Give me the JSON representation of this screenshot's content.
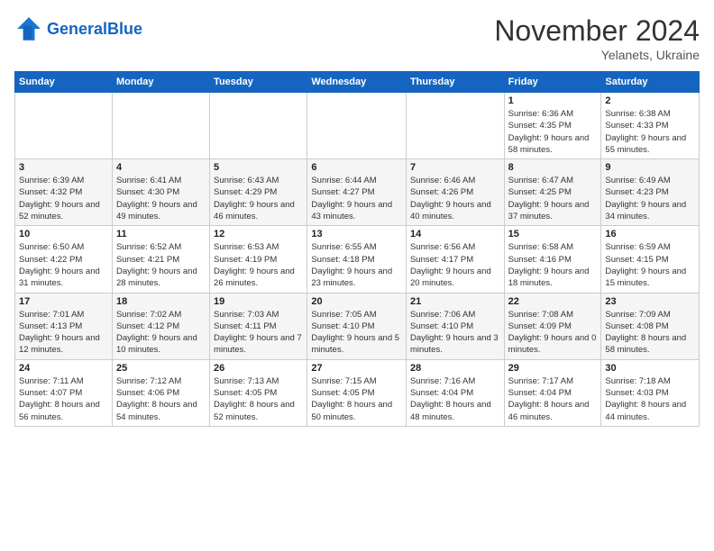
{
  "header": {
    "logo_text_general": "General",
    "logo_text_blue": "Blue",
    "month": "November 2024",
    "location": "Yelanets, Ukraine"
  },
  "days_of_week": [
    "Sunday",
    "Monday",
    "Tuesday",
    "Wednesday",
    "Thursday",
    "Friday",
    "Saturday"
  ],
  "weeks": [
    [
      {
        "day": "",
        "info": ""
      },
      {
        "day": "",
        "info": ""
      },
      {
        "day": "",
        "info": ""
      },
      {
        "day": "",
        "info": ""
      },
      {
        "day": "",
        "info": ""
      },
      {
        "day": "1",
        "info": "Sunrise: 6:36 AM\nSunset: 4:35 PM\nDaylight: 9 hours and 58 minutes."
      },
      {
        "day": "2",
        "info": "Sunrise: 6:38 AM\nSunset: 4:33 PM\nDaylight: 9 hours and 55 minutes."
      }
    ],
    [
      {
        "day": "3",
        "info": "Sunrise: 6:39 AM\nSunset: 4:32 PM\nDaylight: 9 hours and 52 minutes."
      },
      {
        "day": "4",
        "info": "Sunrise: 6:41 AM\nSunset: 4:30 PM\nDaylight: 9 hours and 49 minutes."
      },
      {
        "day": "5",
        "info": "Sunrise: 6:43 AM\nSunset: 4:29 PM\nDaylight: 9 hours and 46 minutes."
      },
      {
        "day": "6",
        "info": "Sunrise: 6:44 AM\nSunset: 4:27 PM\nDaylight: 9 hours and 43 minutes."
      },
      {
        "day": "7",
        "info": "Sunrise: 6:46 AM\nSunset: 4:26 PM\nDaylight: 9 hours and 40 minutes."
      },
      {
        "day": "8",
        "info": "Sunrise: 6:47 AM\nSunset: 4:25 PM\nDaylight: 9 hours and 37 minutes."
      },
      {
        "day": "9",
        "info": "Sunrise: 6:49 AM\nSunset: 4:23 PM\nDaylight: 9 hours and 34 minutes."
      }
    ],
    [
      {
        "day": "10",
        "info": "Sunrise: 6:50 AM\nSunset: 4:22 PM\nDaylight: 9 hours and 31 minutes."
      },
      {
        "day": "11",
        "info": "Sunrise: 6:52 AM\nSunset: 4:21 PM\nDaylight: 9 hours and 28 minutes."
      },
      {
        "day": "12",
        "info": "Sunrise: 6:53 AM\nSunset: 4:19 PM\nDaylight: 9 hours and 26 minutes."
      },
      {
        "day": "13",
        "info": "Sunrise: 6:55 AM\nSunset: 4:18 PM\nDaylight: 9 hours and 23 minutes."
      },
      {
        "day": "14",
        "info": "Sunrise: 6:56 AM\nSunset: 4:17 PM\nDaylight: 9 hours and 20 minutes."
      },
      {
        "day": "15",
        "info": "Sunrise: 6:58 AM\nSunset: 4:16 PM\nDaylight: 9 hours and 18 minutes."
      },
      {
        "day": "16",
        "info": "Sunrise: 6:59 AM\nSunset: 4:15 PM\nDaylight: 9 hours and 15 minutes."
      }
    ],
    [
      {
        "day": "17",
        "info": "Sunrise: 7:01 AM\nSunset: 4:13 PM\nDaylight: 9 hours and 12 minutes."
      },
      {
        "day": "18",
        "info": "Sunrise: 7:02 AM\nSunset: 4:12 PM\nDaylight: 9 hours and 10 minutes."
      },
      {
        "day": "19",
        "info": "Sunrise: 7:03 AM\nSunset: 4:11 PM\nDaylight: 9 hours and 7 minutes."
      },
      {
        "day": "20",
        "info": "Sunrise: 7:05 AM\nSunset: 4:10 PM\nDaylight: 9 hours and 5 minutes."
      },
      {
        "day": "21",
        "info": "Sunrise: 7:06 AM\nSunset: 4:10 PM\nDaylight: 9 hours and 3 minutes."
      },
      {
        "day": "22",
        "info": "Sunrise: 7:08 AM\nSunset: 4:09 PM\nDaylight: 9 hours and 0 minutes."
      },
      {
        "day": "23",
        "info": "Sunrise: 7:09 AM\nSunset: 4:08 PM\nDaylight: 8 hours and 58 minutes."
      }
    ],
    [
      {
        "day": "24",
        "info": "Sunrise: 7:11 AM\nSunset: 4:07 PM\nDaylight: 8 hours and 56 minutes."
      },
      {
        "day": "25",
        "info": "Sunrise: 7:12 AM\nSunset: 4:06 PM\nDaylight: 8 hours and 54 minutes."
      },
      {
        "day": "26",
        "info": "Sunrise: 7:13 AM\nSunset: 4:05 PM\nDaylight: 8 hours and 52 minutes."
      },
      {
        "day": "27",
        "info": "Sunrise: 7:15 AM\nSunset: 4:05 PM\nDaylight: 8 hours and 50 minutes."
      },
      {
        "day": "28",
        "info": "Sunrise: 7:16 AM\nSunset: 4:04 PM\nDaylight: 8 hours and 48 minutes."
      },
      {
        "day": "29",
        "info": "Sunrise: 7:17 AM\nSunset: 4:04 PM\nDaylight: 8 hours and 46 minutes."
      },
      {
        "day": "30",
        "info": "Sunrise: 7:18 AM\nSunset: 4:03 PM\nDaylight: 8 hours and 44 minutes."
      }
    ]
  ]
}
